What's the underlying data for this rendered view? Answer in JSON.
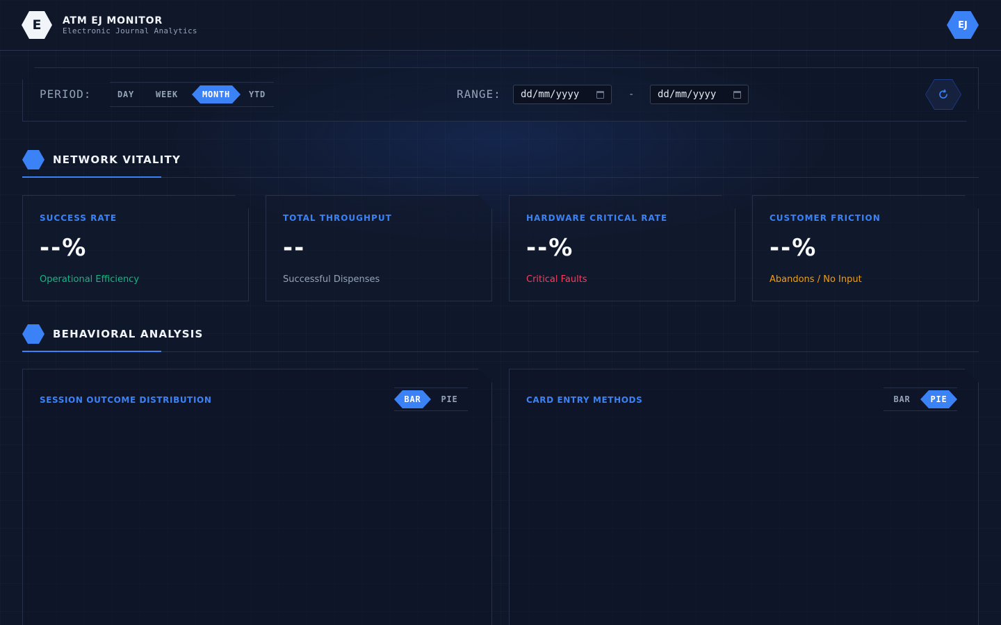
{
  "header": {
    "logo_letter": "E",
    "title": "ATM EJ MONITOR",
    "subtitle": "Electronic Journal Analytics",
    "avatar": "EJ"
  },
  "filters": {
    "period_label": "PERIOD:",
    "periods": [
      {
        "label": "DAY",
        "active": false
      },
      {
        "label": "WEEK",
        "active": false
      },
      {
        "label": "MONTH",
        "active": true
      },
      {
        "label": "YTD",
        "active": false
      }
    ],
    "range_label": "RANGE:",
    "date_from_placeholder": "dd/mm/yyyy",
    "date_to_placeholder": "dd/mm/yyyy",
    "range_separator": "-",
    "refresh_icon": "refresh-icon",
    "calendar_icon": "calendar-icon"
  },
  "sections": {
    "vitality": "NETWORK VITALITY",
    "behavior": "BEHAVIORAL ANALYSIS"
  },
  "kpis": [
    {
      "title": "SUCCESS RATE",
      "value": "--%",
      "subtitle": "Operational Efficiency",
      "subtitle_color": "#10b981"
    },
    {
      "title": "TOTAL THROUGHPUT",
      "value": "--",
      "subtitle": "Successful Dispenses",
      "subtitle_color": "#94a3b8"
    },
    {
      "title": "HARDWARE CRITICAL RATE",
      "value": "--%",
      "subtitle": "Critical Faults",
      "subtitle_color": "#f43f5e"
    },
    {
      "title": "CUSTOMER FRICTION",
      "value": "--%",
      "subtitle": "Abandons / No Input",
      "subtitle_color": "#f59e0b"
    }
  ],
  "panels": [
    {
      "title": "SESSION OUTCOME DISTRIBUTION",
      "toggle": [
        {
          "label": "BAR",
          "active": true
        },
        {
          "label": "PIE",
          "active": false
        }
      ]
    },
    {
      "title": "CARD ENTRY METHODS",
      "toggle": [
        {
          "label": "BAR",
          "active": false
        },
        {
          "label": "PIE",
          "active": true
        }
      ]
    }
  ],
  "colors": {
    "accent": "#3b82f6",
    "background": "#0f172a"
  }
}
